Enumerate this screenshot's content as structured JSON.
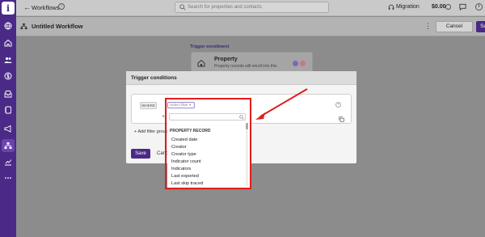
{
  "sidebar": {
    "logo_letter": "i",
    "items": [
      "globe-icon",
      "home-icon",
      "people-icon",
      "dollar-icon",
      "inbox-icon",
      "contacts-icon",
      "list-icon",
      "megaphone-icon",
      "workflow-icon",
      "chart-icon",
      "more-icon"
    ],
    "active_item": "workflow-icon"
  },
  "topbar": {
    "breadcrumb": "Workflows",
    "search_placeholder": "Search for properties and contacts",
    "migration_label": "Migration",
    "balance": "$0.00"
  },
  "workflow": {
    "title": "Untitled Workflow",
    "cancel_label": "Cancel",
    "save_label": "Save"
  },
  "canvas": {
    "trigger_label": "Trigger enrollment",
    "trigger_title": "Property",
    "trigger_subtitle": "Property records will enroll into this"
  },
  "modal": {
    "title": "Trigger conditions",
    "where_label": "WHERE",
    "select_placeholder": "Select filter",
    "add_filter_group": "Add filter group",
    "save_label": "Save",
    "cancel_label": "Cancel"
  },
  "dropdown": {
    "section": "PROPERTY RECORD",
    "options": [
      "Created date",
      "Creator",
      "Creator type",
      "Indicator count",
      "Indicators",
      "Last exported",
      "Last skip traced"
    ]
  },
  "colors": {
    "brand": "#4a2a86",
    "highlight": "#e01e1e"
  }
}
